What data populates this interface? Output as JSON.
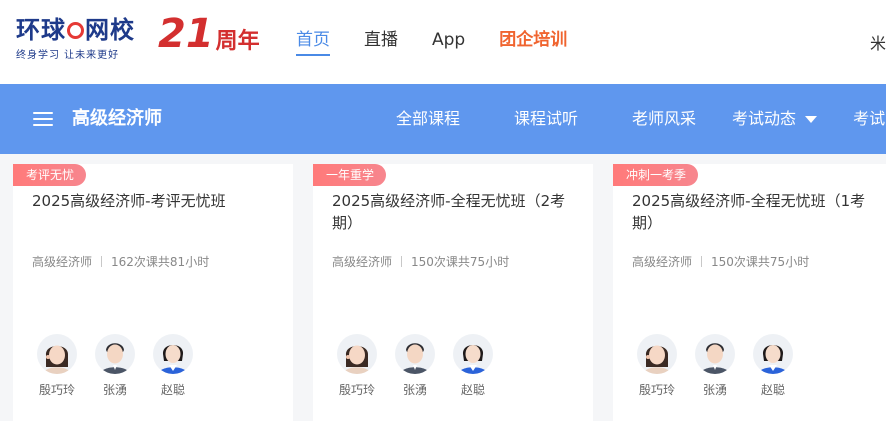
{
  "brand": {
    "logo_text_left": "环球",
    "logo_text_right": "网校",
    "logo_tagline": "终身学习 让未来更好",
    "anniversary_number": "21",
    "anniversary_text": "周年"
  },
  "top_nav": [
    {
      "label": "首页",
      "active": true
    },
    {
      "label": "直播"
    },
    {
      "label": "App"
    },
    {
      "label": "团企培训",
      "highlight_color": "#f0642f"
    }
  ],
  "top_right_partial": "米",
  "category_bar": {
    "background": "#5f97ee",
    "title": "高级经济师",
    "menu_icon": "hamburger-menu-icon",
    "items": [
      {
        "label": "全部课程"
      },
      {
        "label": "课程试听"
      },
      {
        "label": "老师风采"
      },
      {
        "label": "考试动态",
        "has_dropdown": true
      },
      {
        "label": "考试"
      }
    ]
  },
  "courses": [
    {
      "tag": "考评无忧",
      "title": "2025高级经济师-考评无忧班",
      "category": "高级经济师",
      "lessons": "162次课共81小时",
      "teachers": [
        {
          "name": "殷巧玲"
        },
        {
          "name": "张湧"
        },
        {
          "name": "赵聪"
        }
      ]
    },
    {
      "tag": "一年重学",
      "title": "2025高级经济师-全程无忧班（2考期）",
      "category": "高级经济师",
      "lessons": "150次课共75小时",
      "teachers": [
        {
          "name": "殷巧玲"
        },
        {
          "name": "张湧"
        },
        {
          "name": "赵聪"
        }
      ]
    },
    {
      "tag": "冲刺一考季",
      "title": "2025高级经济师-全程无忧班（1考期）",
      "category": "高级经济师",
      "lessons": "150次课共75小时",
      "teachers": [
        {
          "name": "殷巧玲"
        },
        {
          "name": "张湧"
        },
        {
          "name": "赵聪"
        }
      ]
    }
  ],
  "colors": {
    "accent_blue": "#4a8ae6",
    "tag_red": "#ff7a7a",
    "brand_navy": "#1e3a8a",
    "brand_red": "#d32f2f"
  }
}
